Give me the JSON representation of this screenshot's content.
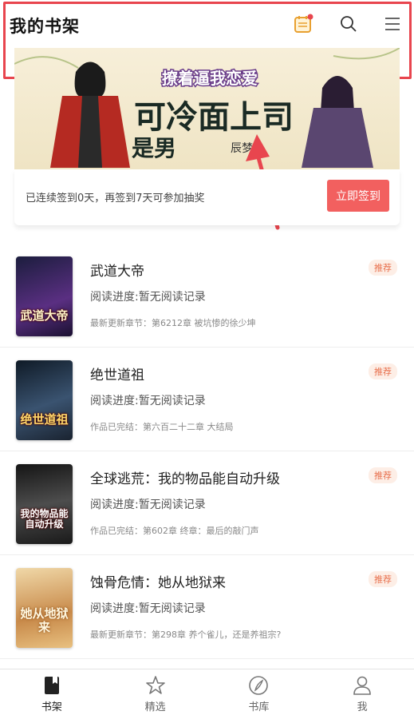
{
  "header": {
    "title": "我的书架",
    "calendar_icon": "calendar-icon",
    "search_icon": "search-icon",
    "menu_icon": "menu-icon"
  },
  "banner": {
    "line1": "撩着逼我恋爱",
    "line2": "可冷面上司",
    "line3": "是男",
    "author": "辰梦"
  },
  "checkin": {
    "text": "已连续签到0天，再签到7天可参加抽奖",
    "button": "立即签到"
  },
  "books": [
    {
      "title": "武道大帝",
      "progress": "阅读进度:暂无阅读记录",
      "chapter": "最新更新章节：第6212章 被坑惨的徐少坤",
      "tag": "推荐",
      "cover_text": "武道大帝",
      "cover_colors": [
        "#1b1d3d",
        "#5a2f82"
      ]
    },
    {
      "title": "绝世道祖",
      "progress": "阅读进度:暂无阅读记录",
      "chapter": "作品已完结：第六百二十二章 大结局",
      "tag": "推荐",
      "cover_text": "绝世道祖",
      "cover_colors": [
        "#0f1a26",
        "#3a5370"
      ]
    },
    {
      "title": "全球逃荒：我的物品能自动升级",
      "progress": "阅读进度:暂无阅读记录",
      "chapter": "作品已完结：第602章 终章：最后的敲门声",
      "tag": "推荐",
      "cover_text": "我的物品能自动升级",
      "cover_colors": [
        "#151515",
        "#4d4d4d"
      ]
    },
    {
      "title": "蚀骨危情：她从地狱来",
      "progress": "阅读进度:暂无阅读记录",
      "chapter": "最新更新章节：第298章 养个雀儿，还是养祖宗?",
      "tag": "推荐",
      "cover_text": "她从地狱来",
      "cover_colors": [
        "#f0d8a8",
        "#c88a4a"
      ]
    }
  ],
  "tabs": [
    {
      "label": "书架",
      "icon": "bookshelf-icon",
      "active": true
    },
    {
      "label": "精选",
      "icon": "star-icon",
      "active": false
    },
    {
      "label": "书库",
      "icon": "compass-icon",
      "active": false
    },
    {
      "label": "我",
      "icon": "user-icon",
      "active": false
    }
  ],
  "colors": {
    "accent": "#f2605f",
    "highlight": "#e8454e",
    "tag_text": "#e8714e",
    "tag_bg": "#fdeee6"
  }
}
